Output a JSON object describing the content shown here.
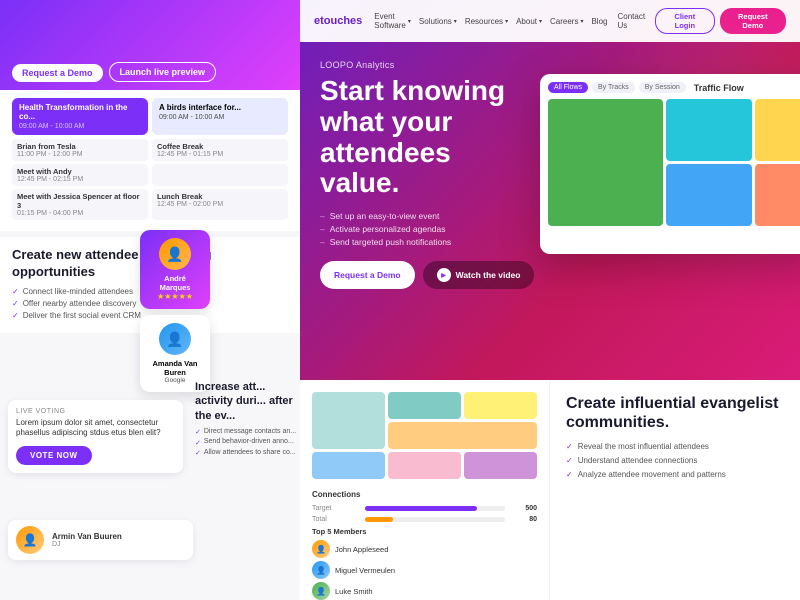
{
  "left": {
    "hero": {
      "btn1": "Request a Demo",
      "btn2": "Launch live preview"
    },
    "schedule": {
      "cards": [
        {
          "title": "Health Transformation in the co...",
          "time": "09:00 AM - 10:00 AM",
          "style": "purple"
        },
        {
          "title": "A birds interface for...",
          "time": "09:00 AM - 10:00 AM",
          "style": "default"
        }
      ],
      "rows": [
        [
          {
            "name": "Brian from Tesla",
            "time": "11:00 PM - 12:00 PM"
          },
          {
            "name": "Coffee Break",
            "time": "12:45 PM - 01:15 PM"
          }
        ],
        [
          {
            "name": "Meet with Andy",
            "time": "12:45 PM - 02:15 PM"
          },
          {
            "name": "",
            "time": ""
          }
        ],
        [
          {
            "name": "Meet with Jessica Spencer at floor 3",
            "time": "01:15 PM - 04:00 PM"
          },
          {
            "name": "Lunch Break",
            "time": "12:45 PM - 02:00 PM"
          }
        ]
      ]
    },
    "networking": {
      "title": "Create new attendee networking opportunities",
      "bullets": [
        "Connect like-minded attendees",
        "Offer nearby attendee discovery",
        "Deliver the first social event CRM"
      ]
    },
    "profiles": [
      {
        "name": "André Marques",
        "stars": "★★★★★",
        "style": "purple"
      },
      {
        "name": "Amanda Van Buren",
        "company": "Google",
        "style": "default"
      }
    ],
    "voting": {
      "label": "LIVE VOTING",
      "text": "Lorem ipsum dolor sit amet, consectetur phasellus adipiscing stdus etus blen elit?",
      "btn": "VOTE NOW"
    },
    "increase": {
      "title": "Increase att... activity duri... after the ev...",
      "bullets": [
        "Direct message contacts an...",
        "Send behavior-driven anno...",
        "Allow attendees to share co..."
      ]
    },
    "bottomProfile": {
      "name": "Armin Van Buuren",
      "role": "DJ"
    }
  },
  "right": {
    "nav": {
      "logo": "etouches",
      "links": [
        "Event Software",
        "Solutions",
        "Resources",
        "About",
        "Careers"
      ],
      "linksNoArrow": [
        "Blog",
        "Contact Us"
      ],
      "btnOutline": "Client Login",
      "btnFilled": "Request Demo"
    },
    "hero": {
      "label": "LOOPO Analytics",
      "titleLine1": "Start knowing",
      "titleLine2": "what your",
      "titleLine3": "attendees",
      "titleLine4": "value.",
      "bullets": [
        "Set up an easy-to-view event",
        "Activate personalized agendas",
        "Send targeted push notifications"
      ],
      "btn1": "Request a Demo",
      "btn2": "Watch the video"
    },
    "dashboard": {
      "title": "Traffic Flow",
      "tabs": [
        "All Flows",
        "By Tracks",
        "By Session"
      ],
      "cells": [
        {
          "color": "green",
          "label": ""
        },
        {
          "color": "teal",
          "label": ""
        },
        {
          "color": "yellow",
          "label": ""
        },
        {
          "color": "blue",
          "label": ""
        },
        {
          "color": "orange",
          "label": ""
        },
        {
          "color": "pink",
          "label": ""
        }
      ]
    },
    "analytics": {
      "minimap": true,
      "connections": {
        "title": "Connections",
        "target_label": "Target",
        "target_val": "500",
        "total_label": "Total",
        "total_val": "80"
      },
      "topMembers": {
        "title": "Top 5 Members",
        "members": [
          {
            "name": "John Appleseed",
            "role": ""
          },
          {
            "name": "Miguel Vermeulen",
            "role": ""
          },
          {
            "name": "Luke Smith",
            "role": ""
          }
        ]
      }
    },
    "evangelist": {
      "title": "Create influential evangelist communities.",
      "bullets": [
        "Reveal the most influential attendees",
        "Understand attendee connections",
        "Analyze attendee movement and patterns"
      ]
    }
  }
}
